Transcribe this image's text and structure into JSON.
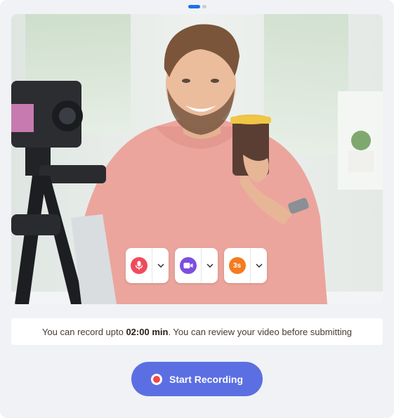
{
  "colors": {
    "accent": "#5b6fe3",
    "pager_active": "#1a73e8",
    "mic": "#ef4b5c",
    "camera": "#7b4fe0",
    "timer": "#f47b20",
    "record_dot": "#f04848"
  },
  "pager": {
    "total": 2,
    "active_index": 0
  },
  "controls": [
    {
      "icon": "microphone-icon"
    },
    {
      "icon": "video-camera-icon"
    },
    {
      "icon": "timer-icon",
      "label": "3s"
    }
  ],
  "info": {
    "prefix": "You can record upto ",
    "duration": "02:00 min",
    "suffix": ". You can review your video before submitting"
  },
  "record_button": {
    "label": "Start Recording"
  }
}
